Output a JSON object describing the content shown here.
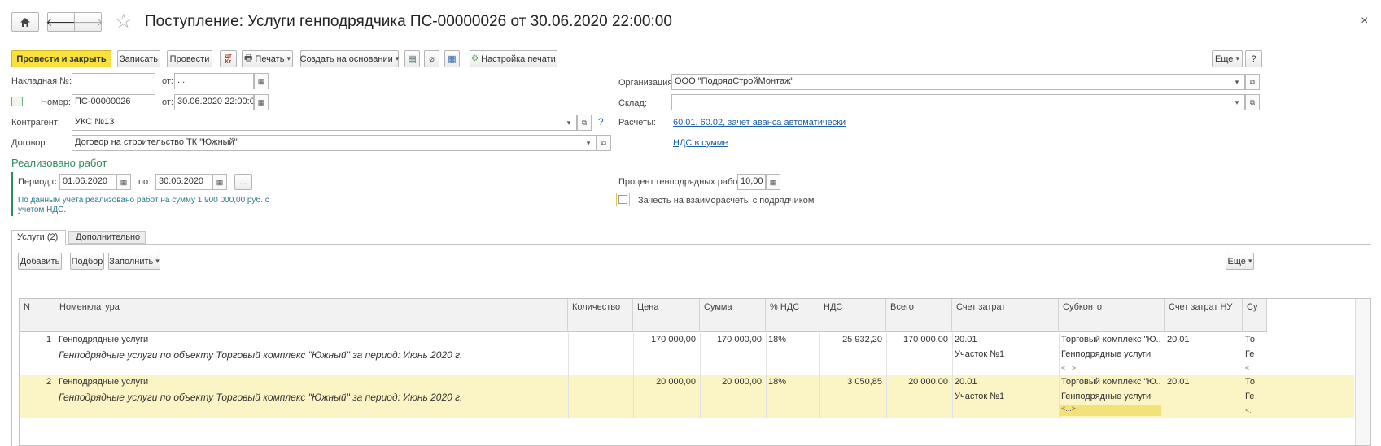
{
  "header": {
    "title": "Поступление: Услуги генподрядчика ПС-00000026 от 30.06.2020 22:00:00",
    "close_glyph": "×"
  },
  "toolbar": {
    "post_close": "Провести и закрыть",
    "save": "Записать",
    "post": "Провести",
    "print": "Печать",
    "create_based": "Создать на основании",
    "print_settings": "Настройка печати",
    "more": "Еще",
    "help": "?"
  },
  "form": {
    "invoice_label": "Накладная  №:",
    "invoice_value": "",
    "invoice_from_label": "от:",
    "invoice_date": " .  .",
    "number_label": "Номер:",
    "number_value": "ПС-00000026",
    "number_from_label": "от:",
    "number_date": "30.06.2020 22:00:00",
    "counterparty_label": "Контрагент:",
    "counterparty_value": "УКС №13",
    "contract_label": "Договор:",
    "contract_value": "Договор на строительство ТК \"Южный\"",
    "org_label": "Организация:",
    "org_value": "ООО \"ПодрядСтройМонтаж\"",
    "warehouse_label": "Склад:",
    "warehouse_value": "",
    "settlements_label": "Расчеты:",
    "settlements_link": "60.01, 60.02, зачет аванса автоматически",
    "vat_link": "НДС в сумме",
    "help_q": "?"
  },
  "works": {
    "section_title": "Реализовано работ",
    "period_from_label": "Период с:",
    "period_from": "01.06.2020",
    "period_to_label": "по:",
    "period_to": "30.06.2020",
    "ellipsis": "...",
    "info_line1": "По данным учета реализовано работ на сумму 1 900 000,00 руб. с",
    "info_line2": "учетом НДС.",
    "percent_label": "Процент генподрядных работ:",
    "percent_value": "10,00",
    "offset_checkbox_label": "Зачесть на взаиморасчеты с подрядчиком",
    "offset_checked": false
  },
  "tabs": [
    {
      "label": "Услуги (2)",
      "active": true
    },
    {
      "label": "Дополнительно",
      "active": false
    }
  ],
  "table_toolbar": {
    "add": "Добавить",
    "select": "Подбор",
    "fill": "Заполнить",
    "more": "Еще"
  },
  "table": {
    "columns": [
      "N",
      "Номенклатура",
      "Количество",
      "Цена",
      "Сумма",
      "% НДС",
      "НДС",
      "Всего",
      "Счет затрат",
      "Субконто",
      "Счет затрат НУ",
      "Су"
    ],
    "rows": [
      {
        "n": "1",
        "item": "Генподрядные услуги",
        "description": "Генподрядные услуги по объекту Торговый комплекс \"Южный\" за период: Июнь 2020 г.",
        "quantity": "",
        "price": "170 000,00",
        "sum": "170 000,00",
        "vat_rate": "18%",
        "vat": "25 932,20",
        "total": "170 000,00",
        "account": "20.01",
        "account_sub": "Участок №1",
        "subconto1": "Торговый комплекс \"Ю...",
        "subconto2": "Генподрядные услуги",
        "subconto3": "<...>",
        "account_nu": "20.01",
        "su1": "То",
        "su2": "Ге",
        "su3": "<."
      },
      {
        "n": "2",
        "item": "Генподрядные услуги",
        "description": "Генподрядные услуги по объекту Торговый комплекс \"Южный\" за период: Июнь 2020 г.",
        "quantity": "",
        "price": "20 000,00",
        "sum": "20 000,00",
        "vat_rate": "18%",
        "vat": "3 050,85",
        "total": "20 000,00",
        "account": "20.01",
        "account_sub": "Участок №1",
        "subconto1": "Торговый комплекс \"Ю...",
        "subconto2": "Генподрядные услуги",
        "subconto3": "<...>",
        "account_nu": "20.01",
        "su1": "То",
        "su2": "Ге",
        "su3": "<."
      }
    ]
  },
  "colors": {
    "accent_yellow": "#f9e03b",
    "section_green": "#2e8b57",
    "link_blue": "#1f5fa8",
    "selected_row": "#fbf4c4"
  }
}
